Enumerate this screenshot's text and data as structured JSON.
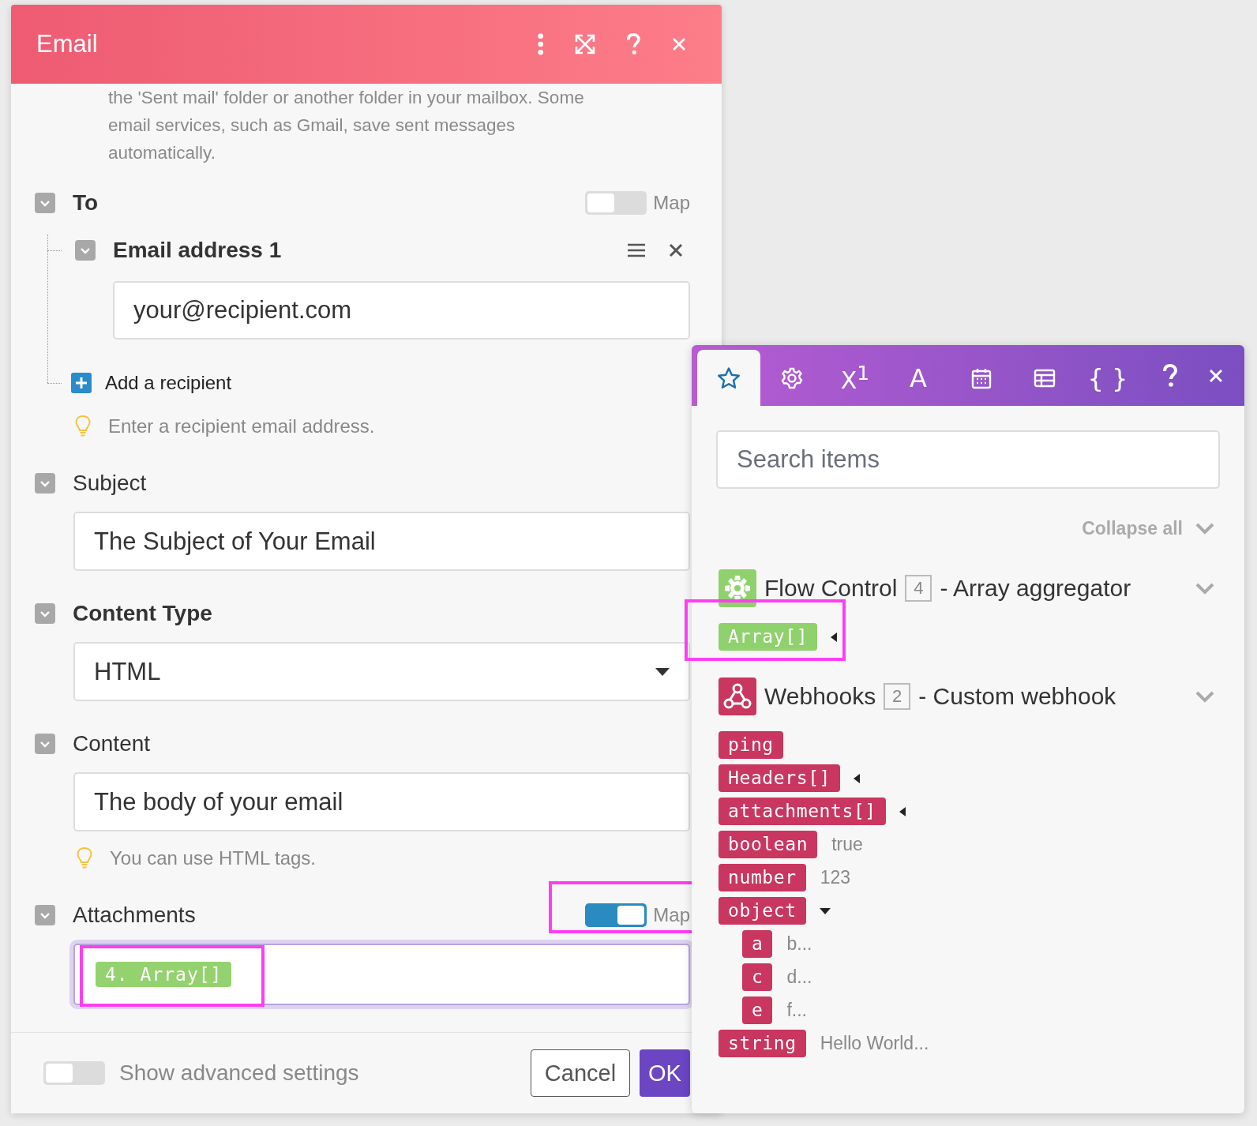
{
  "dialog": {
    "title": "Email",
    "description": "the 'Sent mail' folder or another folder in your mailbox. Some email services, such as Gmail, save sent messages automatically.",
    "to": {
      "label": "To",
      "map": {
        "label": "Map",
        "on": false
      },
      "items": [
        {
          "label": "Email address 1",
          "value": "your@recipient.com"
        }
      ],
      "add_label": "Add a recipient",
      "hint": "Enter a recipient email address."
    },
    "fields": [
      {
        "kind": "text",
        "label": "Subject",
        "bold": false,
        "value": "The Subject of Your Email"
      },
      {
        "kind": "select",
        "label": "Content Type",
        "bold": true,
        "value": "HTML"
      },
      {
        "kind": "text",
        "label": "Content",
        "bold": false,
        "value": "The body of your email",
        "hint": "You can use HTML tags."
      },
      {
        "kind": "mapped",
        "label": "Attachments",
        "bold": false,
        "map": {
          "label": "Map",
          "on": true,
          "highlighted": true
        },
        "token": {
          "text": "4. Array[]",
          "highlighted": true
        }
      }
    ],
    "advanced": {
      "label": "Show advanced settings",
      "on": false
    },
    "buttons": [
      {
        "label": "Cancel",
        "kind": "secondary"
      },
      {
        "label": "OK",
        "kind": "primary"
      }
    ]
  },
  "panel": {
    "tabs": [
      {
        "kind": "favorites",
        "selected": true
      },
      {
        "kind": "settings",
        "selected": false
      },
      {
        "kind": "math",
        "label": "X$^{1}$",
        "selected": false
      },
      {
        "kind": "text",
        "label": "A",
        "selected": false
      },
      {
        "kind": "date",
        "selected": false
      },
      {
        "kind": "table",
        "selected": false
      },
      {
        "kind": "json",
        "label": "{ }",
        "selected": false
      }
    ],
    "search": {
      "placeholder": "Search items"
    },
    "collapse_label": "Collapse all",
    "modules": [
      {
        "kind": "flow",
        "name": "Flow Control",
        "number": "4",
        "description": "- Array aggregator",
        "color": "#8fd16c",
        "items": [
          {
            "key": "Array[]",
            "expanded": false,
            "highlighted": true
          }
        ]
      },
      {
        "kind": "webhook",
        "name": "Webhooks",
        "number": "2",
        "description": "- Custom webhook",
        "color": "#c9365f",
        "items": [
          {
            "key": "ping"
          },
          {
            "key": "Headers[]",
            "expanded": false
          },
          {
            "key": "attachments[]",
            "expanded": false
          },
          {
            "key": "boolean",
            "value": "true"
          },
          {
            "key": "number",
            "value": "123"
          },
          {
            "key": "object",
            "expanded": true,
            "children": [
              {
                "key": "a",
                "value": "b..."
              },
              {
                "key": "c",
                "value": "d..."
              },
              {
                "key": "e",
                "value": "f..."
              }
            ]
          },
          {
            "key": "string",
            "value": "Hello World..."
          }
        ]
      }
    ]
  }
}
